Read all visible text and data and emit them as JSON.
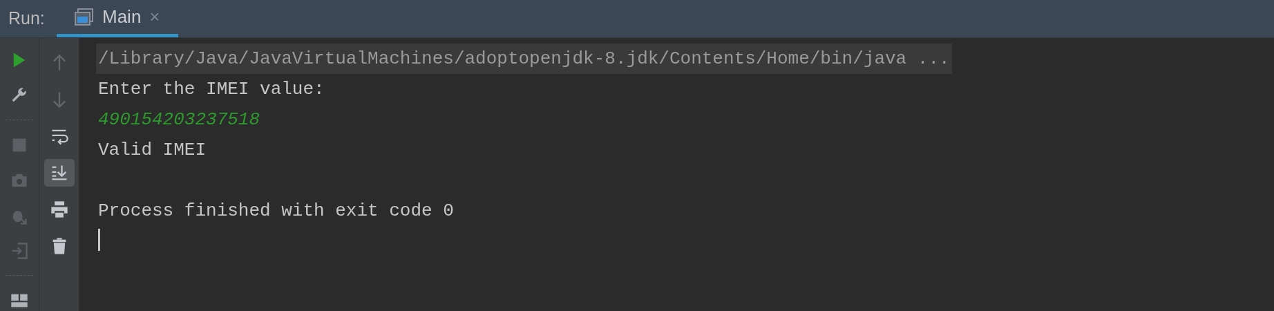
{
  "header": {
    "label": "Run:",
    "tabs": [
      {
        "label": "Main",
        "selected": true,
        "close": "×"
      }
    ]
  },
  "left_toolbar": [
    {
      "kind": "run",
      "disabled": false
    },
    {
      "kind": "settings",
      "disabled": false
    },
    {
      "kind": "separator"
    },
    {
      "kind": "stop",
      "disabled": true
    },
    {
      "kind": "camera",
      "disabled": true
    },
    {
      "kind": "debug",
      "disabled": true
    },
    {
      "kind": "exit",
      "disabled": true
    },
    {
      "kind": "separator"
    },
    {
      "kind": "layout",
      "disabled": false
    }
  ],
  "console_toolbar": [
    {
      "kind": "up",
      "selected": false,
      "disabled": true
    },
    {
      "kind": "down",
      "selected": false,
      "disabled": true
    },
    {
      "kind": "wrap",
      "selected": false,
      "disabled": false
    },
    {
      "kind": "scroll_end",
      "selected": true,
      "disabled": false
    },
    {
      "kind": "print",
      "selected": false,
      "disabled": false
    },
    {
      "kind": "trash",
      "selected": false,
      "disabled": false
    }
  ],
  "console": {
    "lines": [
      {
        "kind": "command",
        "text": "/Library/Java/JavaVirtualMachines/adoptopenjdk-8.jdk/Contents/Home/bin/java ..."
      },
      {
        "kind": "output",
        "text": "Enter the IMEI value:"
      },
      {
        "kind": "input",
        "text": "490154203237518"
      },
      {
        "kind": "output",
        "text": "Valid IMEI"
      },
      {
        "kind": "blank"
      },
      {
        "kind": "output",
        "text": "Process finished with exit code 0"
      }
    ],
    "cursor": true
  }
}
